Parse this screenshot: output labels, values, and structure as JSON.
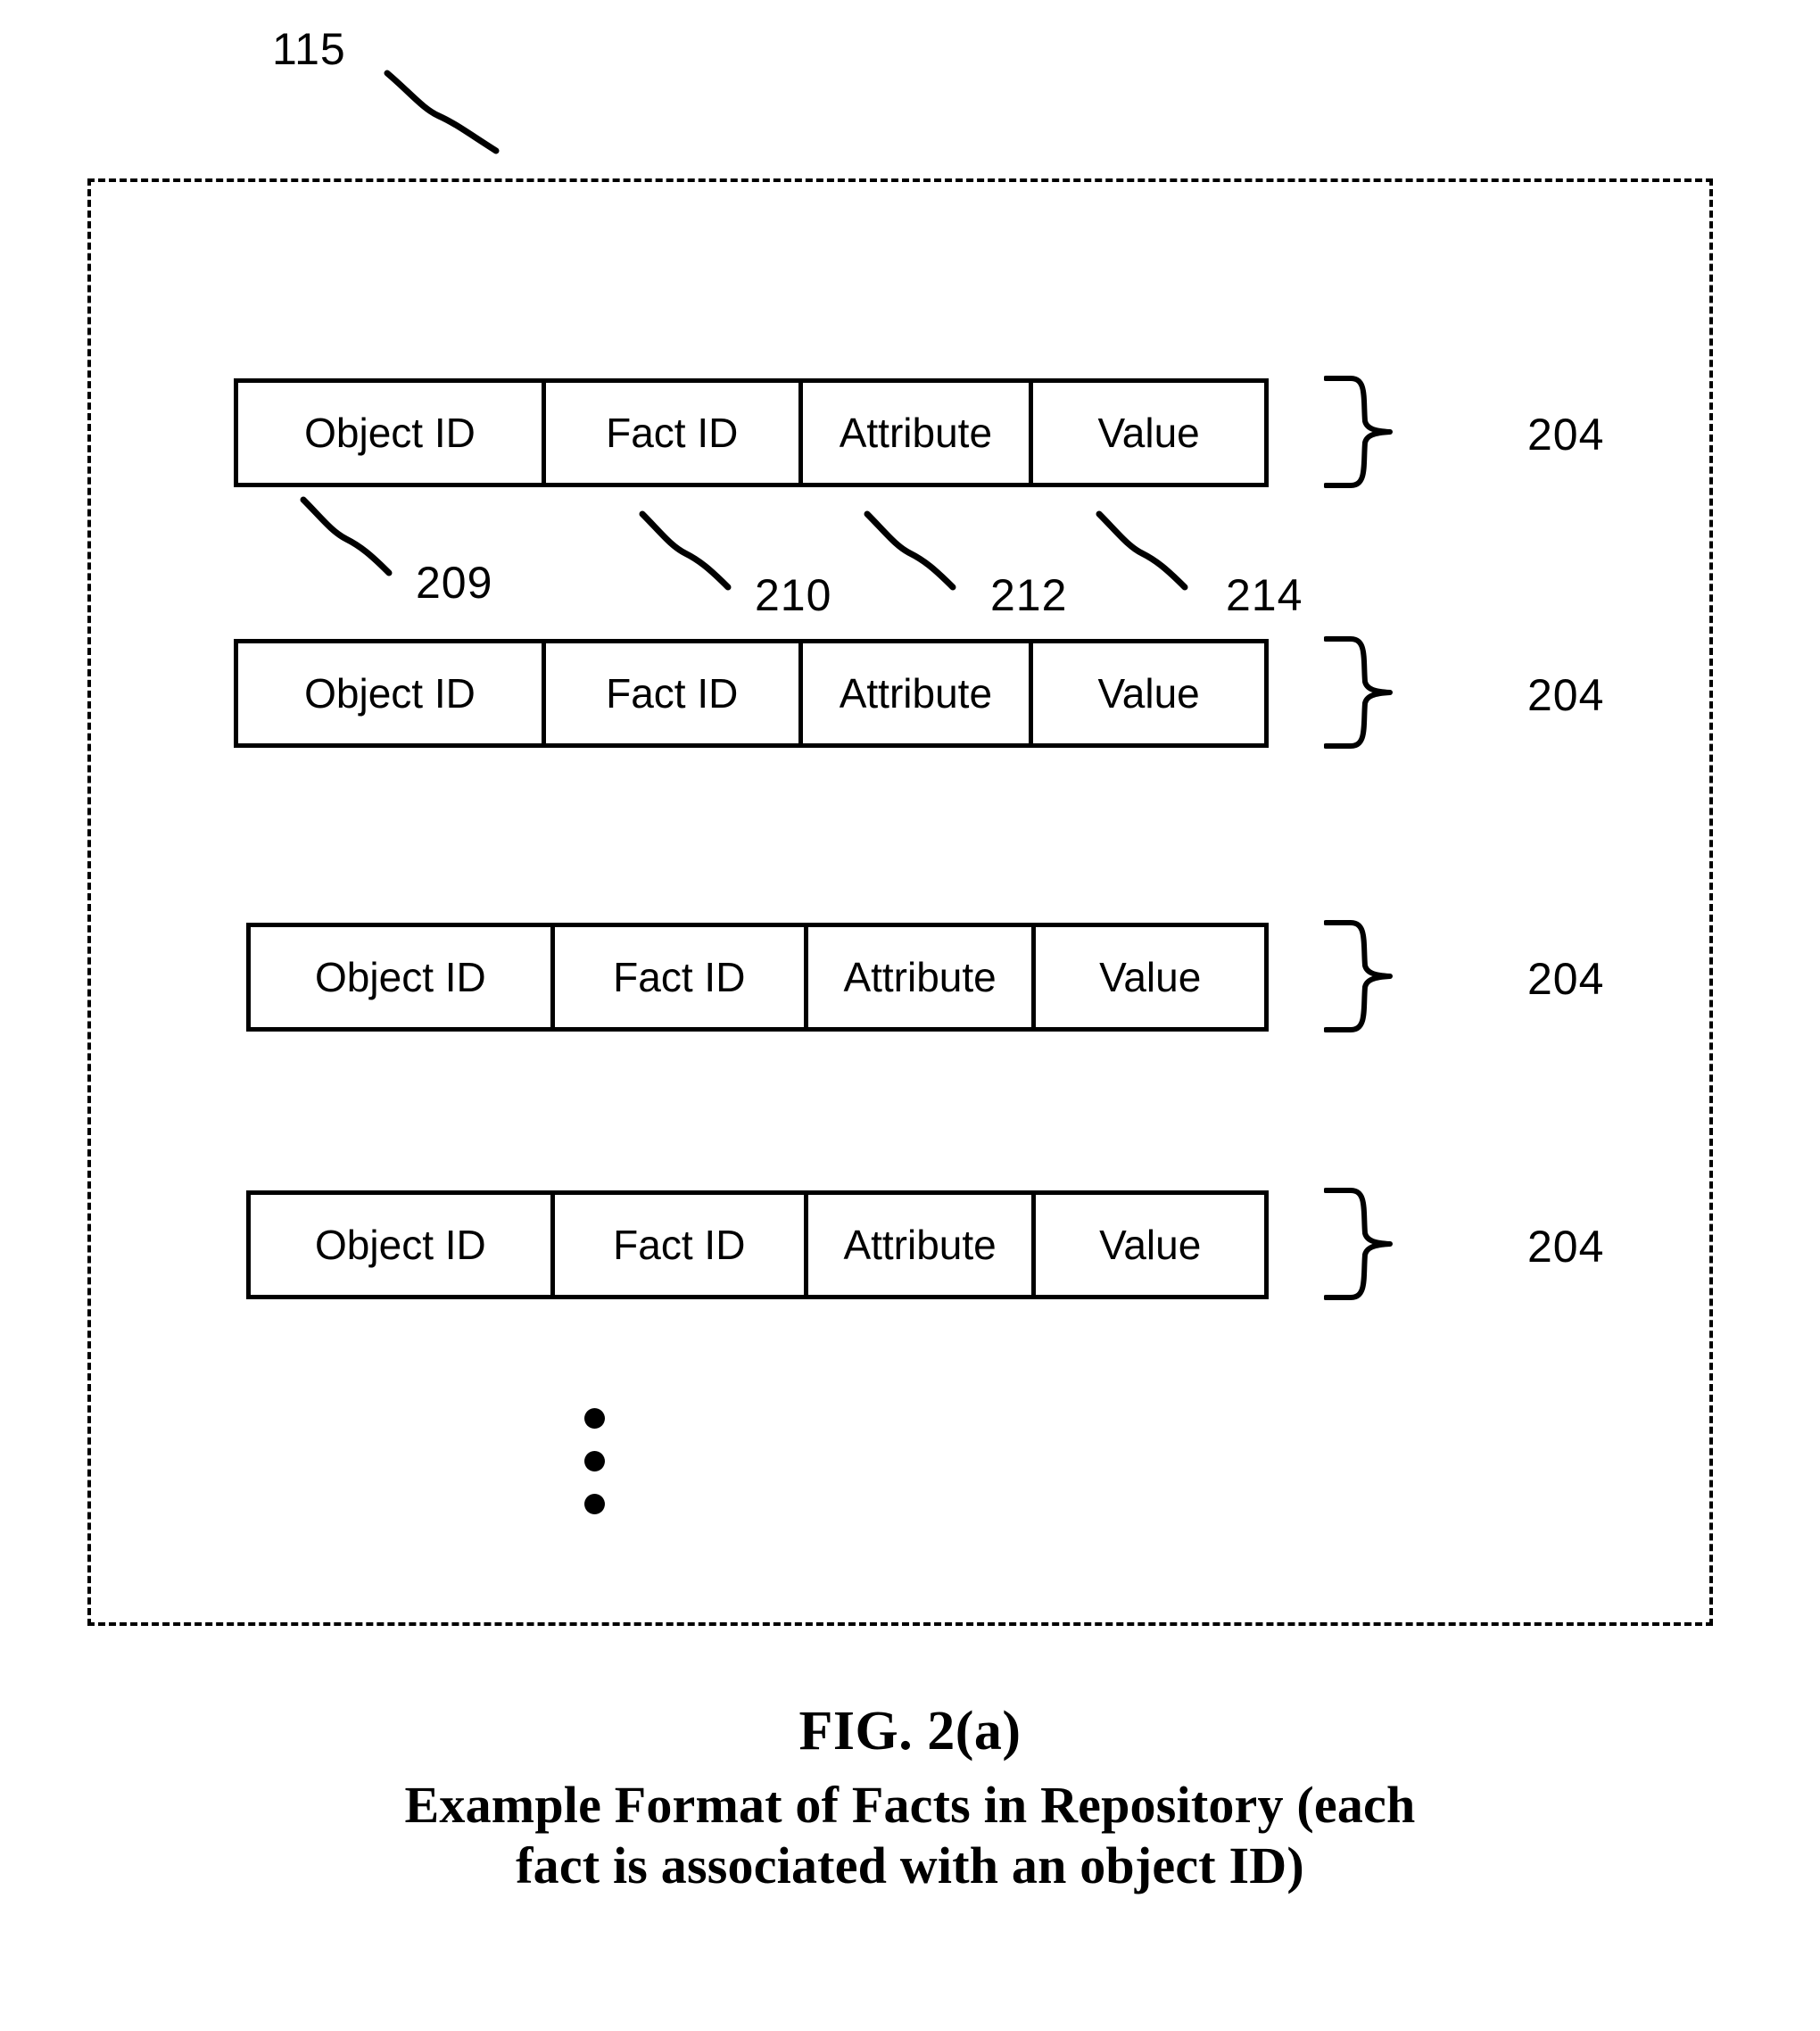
{
  "figure": {
    "reference_numeral_top": "115",
    "caption": {
      "fig_number": "FIG. 2(a)",
      "title_line_1": "Example Format of Facts in Repository (each",
      "title_line_2": "fact is associated with an object ID)"
    }
  },
  "columns": {
    "headers": [
      "Object ID",
      "Fact ID",
      "Attribute",
      "Value"
    ],
    "reference_numerals": [
      "209",
      "210",
      "212",
      "214"
    ]
  },
  "rows": [
    {
      "cells": [
        "Object ID",
        "Fact ID",
        "Attribute",
        "Value"
      ],
      "brace_label": "204"
    },
    {
      "cells": [
        "Object ID",
        "Fact ID",
        "Attribute",
        "Value"
      ],
      "brace_label": "204"
    },
    {
      "cells": [
        "Object ID",
        "Fact ID",
        "Attribute",
        "Value"
      ],
      "brace_label": "204"
    },
    {
      "cells": [
        "Object ID",
        "Fact ID",
        "Attribute",
        "Value"
      ],
      "brace_label": "204"
    }
  ],
  "continuation": {
    "symbol": "vertical-ellipsis",
    "dot_count": 3
  },
  "colors": {
    "ink": "#000000",
    "background": "#ffffff"
  }
}
